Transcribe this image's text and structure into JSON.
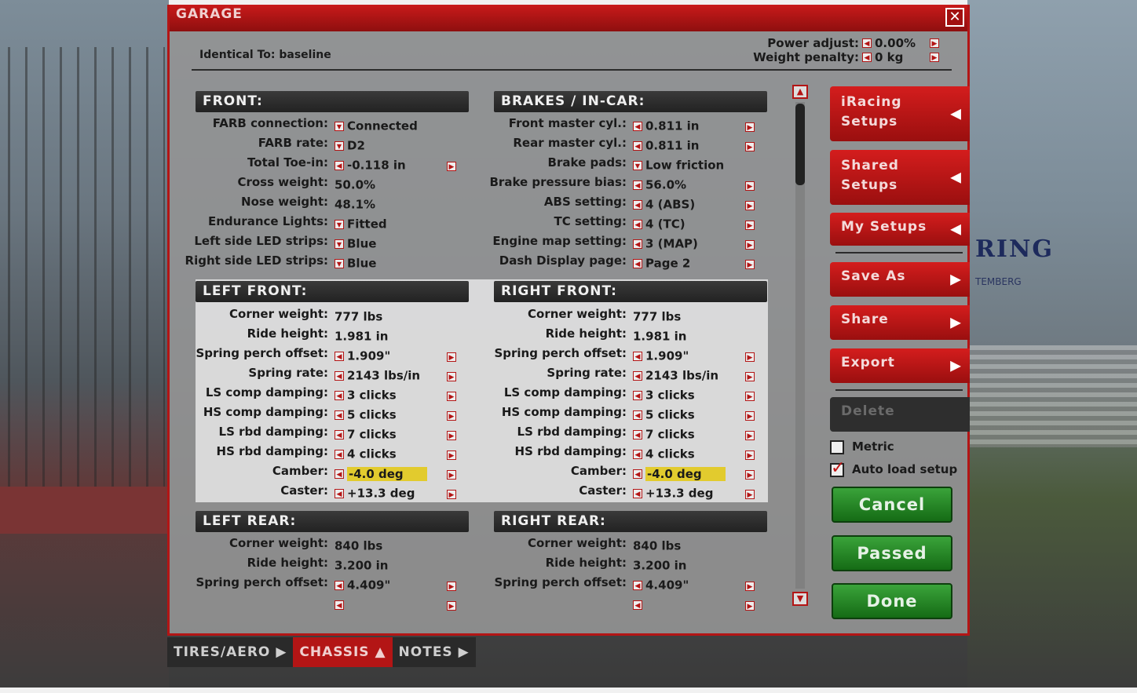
{
  "window": {
    "title": "GARAGE",
    "close_icon": "close-icon"
  },
  "identical_to": "Identical To: baseline",
  "power_adjust": {
    "label": "Power adjust:",
    "value": "0.00%"
  },
  "weight_penalty": {
    "label": "Weight penalty:",
    "value": "0 kg"
  },
  "front": {
    "header": "FRONT:",
    "rows": [
      {
        "label": "FARB connection:",
        "value": "Connected",
        "ctrl": "dropdown"
      },
      {
        "label": "FARB rate:",
        "value": "D2",
        "ctrl": "dropdown"
      },
      {
        "label": "Total Toe-in:",
        "value": "-0.118 in",
        "ctrl": "stepper"
      },
      {
        "label": "Cross weight:",
        "value": "50.0%",
        "ctrl": "none"
      },
      {
        "label": "Nose weight:",
        "value": "48.1%",
        "ctrl": "none"
      },
      {
        "label": "Endurance Lights:",
        "value": "Fitted",
        "ctrl": "dropdown"
      },
      {
        "label": "Left side LED strips:",
        "value": "Blue",
        "ctrl": "dropdown"
      },
      {
        "label": "Right side LED strips:",
        "value": "Blue",
        "ctrl": "dropdown"
      }
    ]
  },
  "brakes": {
    "header": "BRAKES / IN-CAR:",
    "rows": [
      {
        "label": "Front master cyl.:",
        "value": "0.811 in",
        "ctrl": "stepper"
      },
      {
        "label": "Rear master cyl.:",
        "value": "0.811 in",
        "ctrl": "stepper"
      },
      {
        "label": "Brake pads:",
        "value": "Low friction",
        "ctrl": "dropdown"
      },
      {
        "label": "Brake pressure bias:",
        "value": "56.0%",
        "ctrl": "stepper"
      },
      {
        "label": "ABS setting:",
        "value": "4 (ABS)",
        "ctrl": "stepper"
      },
      {
        "label": "TC setting:",
        "value": "4 (TC)",
        "ctrl": "stepper"
      },
      {
        "label": "Engine map setting:",
        "value": "3 (MAP)",
        "ctrl": "stepper"
      },
      {
        "label": "Dash Display page:",
        "value": "Page 2",
        "ctrl": "stepper"
      }
    ]
  },
  "left_front": {
    "header": "LEFT FRONT:",
    "rows": [
      {
        "label": "Corner weight:",
        "value": "777 lbs",
        "ctrl": "none"
      },
      {
        "label": "Ride height:",
        "value": "1.981 in",
        "ctrl": "none"
      },
      {
        "label": "Spring perch offset:",
        "value": "1.909\"",
        "ctrl": "stepper"
      },
      {
        "label": "Spring rate:",
        "value": "2143 lbs/in",
        "ctrl": "stepper"
      },
      {
        "label": "LS comp damping:",
        "value": "3 clicks",
        "ctrl": "stepper"
      },
      {
        "label": "HS comp damping:",
        "value": "5 clicks",
        "ctrl": "stepper"
      },
      {
        "label": "LS rbd damping:",
        "value": "7 clicks",
        "ctrl": "stepper"
      },
      {
        "label": "HS rbd damping:",
        "value": "4 clicks",
        "ctrl": "stepper"
      },
      {
        "label": "Camber:",
        "value": "-4.0 deg",
        "ctrl": "stepper",
        "highlight": true
      },
      {
        "label": "Caster:",
        "value": "+13.3 deg",
        "ctrl": "stepper"
      }
    ]
  },
  "right_front": {
    "header": "RIGHT FRONT:",
    "rows": [
      {
        "label": "Corner weight:",
        "value": "777 lbs",
        "ctrl": "none"
      },
      {
        "label": "Ride height:",
        "value": "1.981 in",
        "ctrl": "none"
      },
      {
        "label": "Spring perch offset:",
        "value": "1.909\"",
        "ctrl": "stepper"
      },
      {
        "label": "Spring rate:",
        "value": "2143 lbs/in",
        "ctrl": "stepper"
      },
      {
        "label": "LS comp damping:",
        "value": "3 clicks",
        "ctrl": "stepper"
      },
      {
        "label": "HS comp damping:",
        "value": "5 clicks",
        "ctrl": "stepper"
      },
      {
        "label": "LS rbd damping:",
        "value": "7 clicks",
        "ctrl": "stepper"
      },
      {
        "label": "HS rbd damping:",
        "value": "4 clicks",
        "ctrl": "stepper"
      },
      {
        "label": "Camber:",
        "value": "-4.0 deg",
        "ctrl": "stepper",
        "highlight": true
      },
      {
        "label": "Caster:",
        "value": "+13.3 deg",
        "ctrl": "stepper"
      }
    ]
  },
  "left_rear": {
    "header": "LEFT REAR:",
    "rows": [
      {
        "label": "Corner weight:",
        "value": "840 lbs",
        "ctrl": "none"
      },
      {
        "label": "Ride height:",
        "value": "3.200 in",
        "ctrl": "none"
      },
      {
        "label": "Spring perch offset:",
        "value": "4.409\"",
        "ctrl": "stepper"
      },
      {
        "label": "",
        "value": "",
        "ctrl": "stepper"
      }
    ]
  },
  "right_rear": {
    "header": "RIGHT REAR:",
    "rows": [
      {
        "label": "Corner weight:",
        "value": "840 lbs",
        "ctrl": "none"
      },
      {
        "label": "Ride height:",
        "value": "3.200 in",
        "ctrl": "none"
      },
      {
        "label": "Spring perch offset:",
        "value": "4.409\"",
        "ctrl": "stepper"
      },
      {
        "label": "",
        "value": "",
        "ctrl": "stepper"
      }
    ]
  },
  "side": {
    "iracing_setups": "iRacing Setups",
    "shared_setups": "Shared Setups",
    "my_setups": "My Setups",
    "save_as": "Save As",
    "share": "Share",
    "export": "Export",
    "delete": "Delete",
    "metric": "Metric",
    "auto_load": "Auto load setup",
    "cancel": "Cancel",
    "passed": "Passed",
    "done": "Done"
  },
  "tabs": [
    {
      "label": "TIRES/AERO",
      "icon": "triangle-right-icon"
    },
    {
      "label": "CHASSIS",
      "icon": "triangle-up-icon",
      "active": true
    },
    {
      "label": "NOTES",
      "icon": "triangle-right-icon"
    }
  ],
  "background": {
    "sign_text": "RING",
    "sign_sub": "TEMBERG"
  },
  "colors": {
    "accent": "#b31515",
    "highlight": "#e2cb2e",
    "ok": "#2a8a2a"
  }
}
